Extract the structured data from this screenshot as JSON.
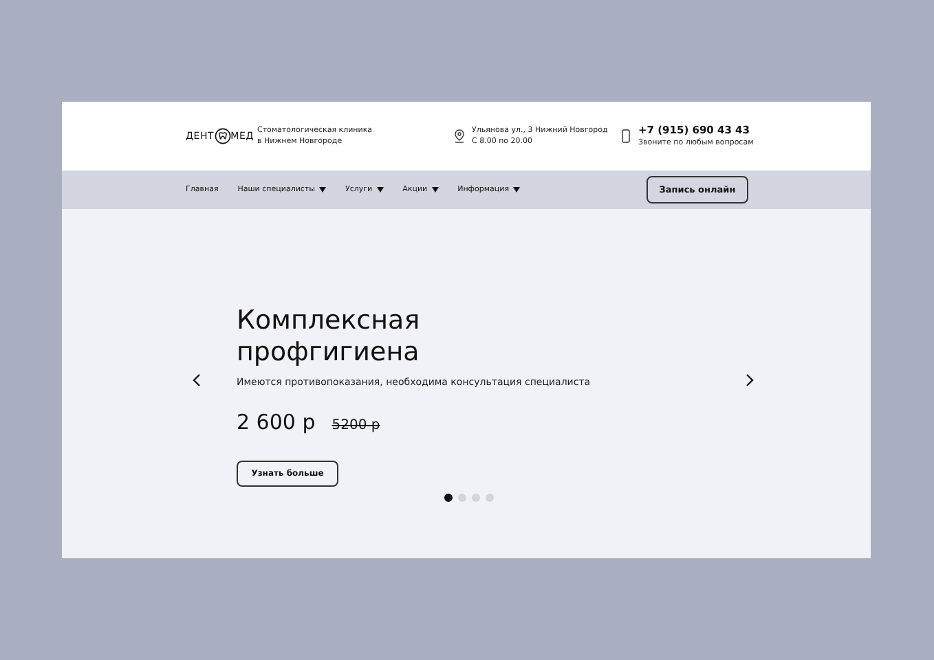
{
  "header": {
    "logo": {
      "left": "ДЕНТ",
      "right": "МЕД"
    },
    "tagline": [
      "Стоматологическая клиника",
      "в Нижнем Новгороде"
    ],
    "address": [
      "Ульянова ул., 3 Нижний Новгород",
      "С 8.00 по 20.00"
    ],
    "phone": "+7 (915) 690 43 43",
    "phone_note": "Звоните по любым вопросам"
  },
  "nav": {
    "items": [
      {
        "label": "Главная",
        "has_dropdown": false
      },
      {
        "label": "Наши специалисты",
        "has_dropdown": true
      },
      {
        "label": "Услуги",
        "has_dropdown": true
      },
      {
        "label": "Акции",
        "has_dropdown": true
      },
      {
        "label": "Информация",
        "has_dropdown": true
      }
    ],
    "button": "Запись онлайн"
  },
  "hero": {
    "title": "Комплексная профгигиена",
    "note": "Имеются противопоказания, необходима консультация специалиста",
    "price": "2 600 р",
    "old_price": "5200 р",
    "button": "Узнать больше",
    "dots": [
      {
        "selected": true
      },
      {
        "selected": false
      },
      {
        "selected": false
      },
      {
        "selected": false
      }
    ]
  }
}
